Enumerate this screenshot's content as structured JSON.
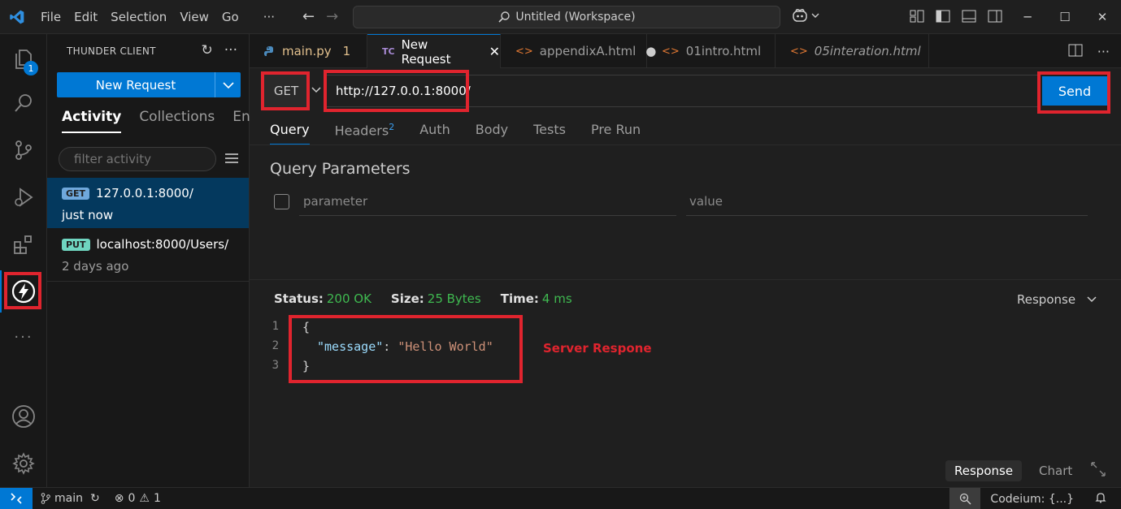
{
  "menu": [
    "File",
    "Edit",
    "Selection",
    "View",
    "Go"
  ],
  "menu_more": "···",
  "command_center": {
    "text": "Untitled (Workspace)"
  },
  "activitybar": {
    "explorer_badge": "1",
    "more": "···"
  },
  "sidebar": {
    "title": "THUNDER CLIENT",
    "new_request_label": "New Request",
    "tabs": [
      "Activity",
      "Collections",
      "Env"
    ],
    "filter_placeholder": "filter activity",
    "items": [
      {
        "method": "GET",
        "url": "127.0.0.1:8000/",
        "time": "just now",
        "badge_color": "#6fa8dc"
      },
      {
        "method": "PUT",
        "url": "localhost:8000/Users/",
        "time": "2 days ago",
        "badge_color": "#6fd5c0"
      }
    ]
  },
  "editor_tabs": [
    {
      "icon": "python-icon",
      "label": "main.py",
      "extra": "1"
    },
    {
      "icon": "thunder-client-icon",
      "icon_text": "TC",
      "label": "New Request"
    },
    {
      "icon": "html-icon",
      "label": "appendixA.html"
    },
    {
      "icon": "html-icon",
      "label": "01intro.html"
    },
    {
      "icon": "html-icon",
      "label": "05interation.html"
    }
  ],
  "request": {
    "method": "GET",
    "url": "http://127.0.0.1:8000/",
    "send_label": "Send",
    "tabs": [
      "Query",
      "Headers",
      "Auth",
      "Body",
      "Tests",
      "Pre Run"
    ],
    "headers_count": "2",
    "query_title": "Query Parameters",
    "param_placeholder": "parameter",
    "value_placeholder": "value"
  },
  "response": {
    "status_label": "Status:",
    "status_value": "200 OK",
    "size_label": "Size:",
    "size_value": "25 Bytes",
    "time_label": "Time:",
    "time_value": "4 ms",
    "view_select": "Response",
    "line_numbers": [
      "1",
      "2",
      "3"
    ],
    "line1": "{",
    "key": "\"message\"",
    "colon": ": ",
    "value": "\"Hello World\"",
    "line3": "}",
    "annotation": "Server Respone",
    "bottom_tabs": [
      "Response",
      "Chart"
    ]
  },
  "statusbar": {
    "branch": "main",
    "errors": "0",
    "warnings": "1",
    "codeium": "Codeium: {...}"
  },
  "colors": {
    "accent": "#0078d4",
    "highlight_box": "#e0242e",
    "success": "#3fb950",
    "json_key": "#9cdcfe",
    "json_string": "#ce9178"
  }
}
